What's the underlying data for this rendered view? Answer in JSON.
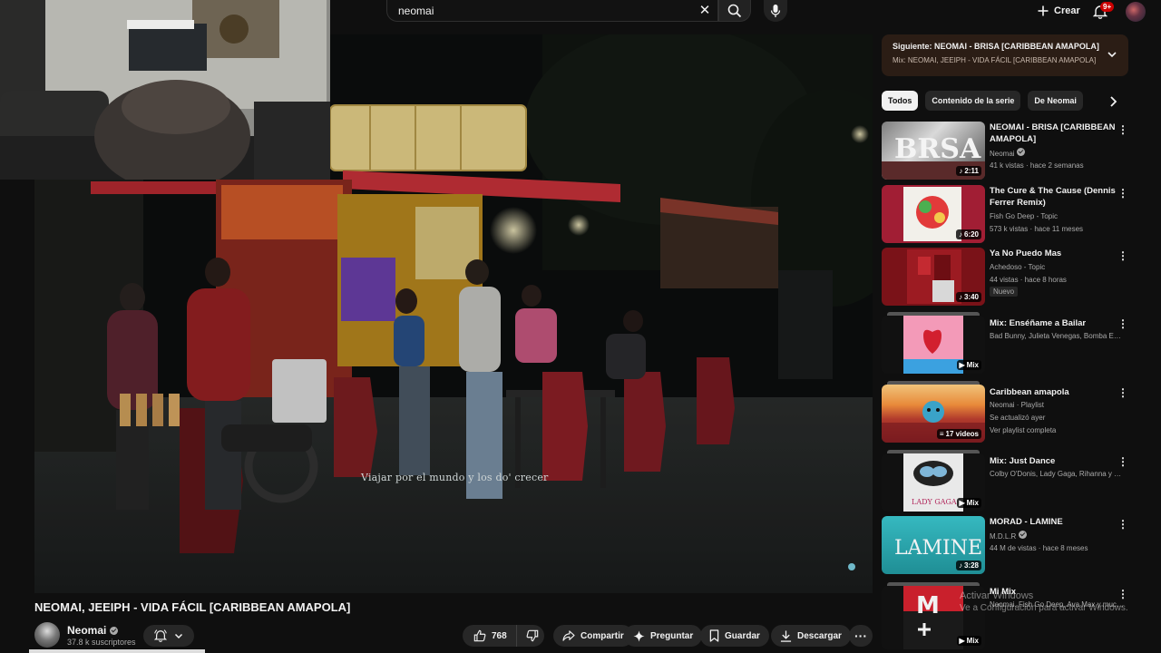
{
  "header": {
    "search_value": "neomai",
    "create_label": "Crear",
    "notifications_badge": "9+"
  },
  "video": {
    "subtitle": "Viajar por el mundo y los do' crecer",
    "title": "NEOMAI, JEEIPH - VIDA FÁCIL [CARIBBEAN AMAPOLA]",
    "channel": "Neomai",
    "subscribers": "37.8 k suscriptores",
    "likes": "768",
    "share_label": "Compartir",
    "ask_label": "Preguntar",
    "save_label": "Guardar",
    "download_label": "Descargar"
  },
  "up_next": {
    "title": "Siguiente: NEOMAI - BRISA [CARIBBEAN AMAPOLA]",
    "subtitle": "Mix: NEOMAI, JEEIPH - VIDA FÁCIL [CARIBBEAN AMAPOLA]"
  },
  "chips": [
    "Todos",
    "Contenido de la serie",
    "De Neomai"
  ],
  "recommendations": [
    {
      "title": "NEOMAI - BRISA [CARIBBEAN AMAPOLA]",
      "channel": "Neomai",
      "verified": true,
      "meta": "41 k vistas · hace 2 semanas",
      "duration": "2:11",
      "thumb_text": "BRSA"
    },
    {
      "title": "The Cure & The Cause (Dennis Ferrer Remix)",
      "channel": "Fish Go Deep - Topic",
      "meta": "573 k vistas · hace 11 meses",
      "duration": "6:20"
    },
    {
      "title": "Ya No Puedo Mas",
      "channel": "Achedoso - Topic",
      "meta": "44 vistas · hace 8 horas",
      "badge": "Nuevo",
      "duration": "3:40"
    },
    {
      "title": "Mix: Enséñame a Bailar",
      "channel": "Bad Bunny, Julieta Venegas, Bomba Esté...",
      "duration": "Mix"
    },
    {
      "title": "Caribbean amapola",
      "channel": "Neomai · Playlist",
      "meta": "Se actualizó ayer",
      "meta2": "Ver playlist completa",
      "duration": "17 videos"
    },
    {
      "title": "Mix: Just Dance",
      "channel": "Colby O'Donis, Lady Gaga, Rihanna y mu...",
      "duration": "Mix",
      "thumb_text": "LADY GAGA"
    },
    {
      "title": "MORAD - LAMINE",
      "channel": "M.D.L.R",
      "verified": true,
      "meta": "44 M de vistas · hace 8 meses",
      "duration": "3:28",
      "thumb_text": "LAMINE"
    },
    {
      "title": "Mi Mix",
      "channel": "Neomai, Fish Go Deep, Ava Max y mucho...",
      "duration": "Mix",
      "thumb_text": "M"
    }
  ],
  "watermark": {
    "line1": "Activar Windows",
    "line2": "Ve a Configuración para activar Windows."
  },
  "colors": {
    "background": "#0f0f0f",
    "chip_bg": "#272727",
    "upnext_bg": "#2b1d15",
    "badge_red": "#cc0000"
  }
}
